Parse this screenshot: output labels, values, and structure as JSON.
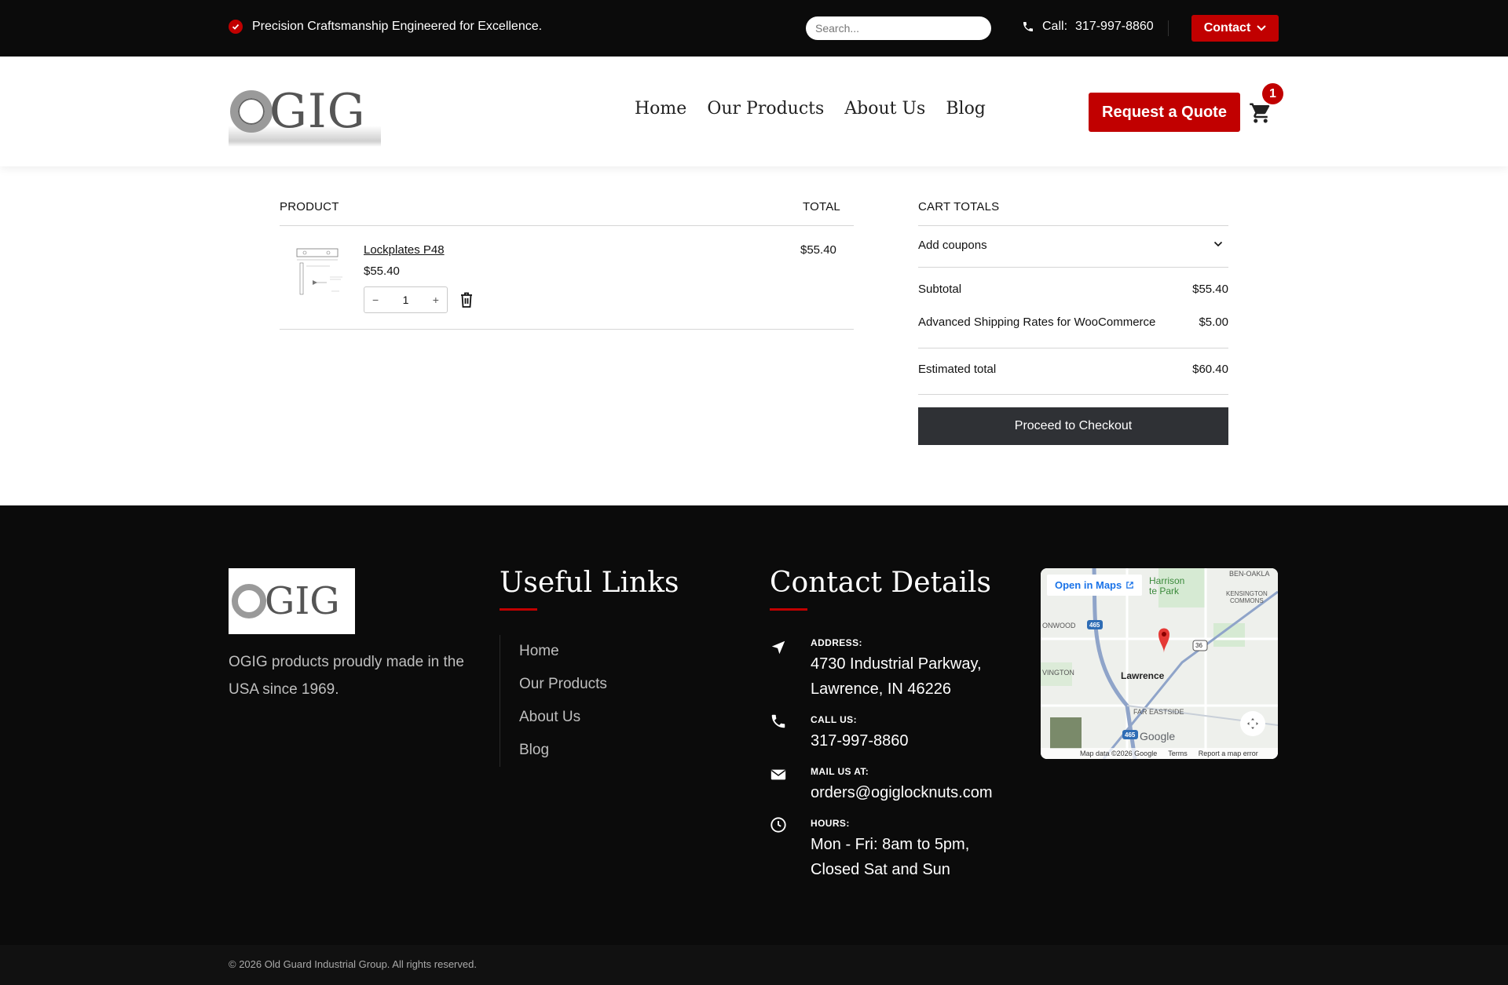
{
  "topbar": {
    "tagline": "Precision Craftsmanship Engineered for Excellence.",
    "search_placeholder": "Search...",
    "call_label": "Call:",
    "phone": "317-997-8860",
    "contact_label": "Contact"
  },
  "header": {
    "logo_text": "GIG",
    "nav": [
      "Home",
      "Our Products",
      "About Us",
      "Blog"
    ],
    "quote_label": "Request a Quote",
    "cart_count": "1"
  },
  "cart": {
    "col_product": "PRODUCT",
    "col_total": "TOTAL",
    "item": {
      "name": "Lockplates P48",
      "price": "$55.40",
      "qty": "1",
      "total": "$55.40"
    }
  },
  "totals": {
    "heading": "CART TOTALS",
    "coupons_label": "Add coupons",
    "subtotal_label": "Subtotal",
    "subtotal": "$55.40",
    "shipping_label": "Advanced Shipping Rates for WooCommerce",
    "shipping": "$5.00",
    "estimated_label": "Estimated total",
    "estimated": "$60.40",
    "checkout_label": "Proceed to Checkout"
  },
  "footer": {
    "logo_text": "GIG",
    "about": "OGIG products proudly made in the USA since 1969.",
    "links_title": "Useful Links",
    "links": [
      "Home",
      "Our Products",
      "About Us",
      "Blog"
    ],
    "contact_title": "Contact Details",
    "address_label": "ADDRESS:",
    "address_line1": "4730 Industrial Parkway,",
    "address_line2": "Lawrence, IN 46226",
    "call_label": "CALL US:",
    "phone": "317-997-8860",
    "mail_label": "MAIL US AT:",
    "email": "orders@ogiglocknuts.com",
    "hours_label": "HOURS:",
    "hours_line1": "Mon - Fri: 8am to 5pm,",
    "hours_line2": "Closed Sat and Sun",
    "map": {
      "open_label": "Open in Maps",
      "city": "Lawrence",
      "places": [
        "Harrison",
        "te Park",
        "BEN-OAKLA",
        "KENSINGTON",
        "COMMONS",
        "ONWOOD",
        "VINGTON",
        "FAR EASTSIDE"
      ],
      "roads": [
        "465",
        "36",
        "465"
      ],
      "google": "Google",
      "map_data": "Map data ©2026 Google",
      "terms": "Terms",
      "report": "Report a map error"
    },
    "copyright": "© 2026 Old Guard Industrial Group. All rights reserved."
  },
  "colors": {
    "accent": "#c10000",
    "dark": "#0b0b0b",
    "button_dark": "#2f3135"
  }
}
